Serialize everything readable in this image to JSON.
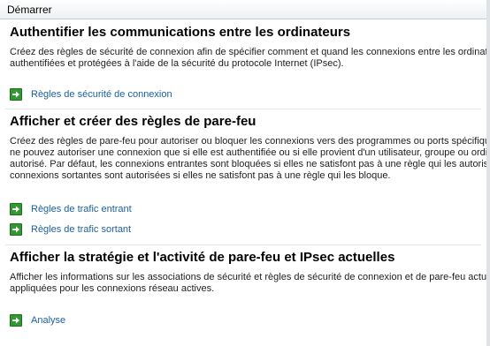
{
  "titlebar": {
    "title": "Démarrer"
  },
  "sections": [
    {
      "heading": "Authentifier les communications entre les ordinateurs",
      "desc_lines": [
        "Créez des règles de sécurité de connexion afin de spécifier comment et quand les connexions entre les ordinateurs",
        "authentifiées et protégées à l'aide de la sécurité du protocole Internet (IPsec)."
      ],
      "links": [
        {
          "label": "Règles de sécurité de connexion",
          "icon": "green-arrow-icon"
        }
      ]
    },
    {
      "heading": "Afficher et créer des règles de pare-feu",
      "desc_lines": [
        "Créez des règles de pare-feu pour autoriser ou bloquer les connexions vers des programmes ou ports spécifiques. V",
        "ne pouvez autoriser une connexion que si elle est authentifiée ou si elle provient d'un utilisateur, groupe ou ordinate",
        "autorisé. Par défaut, les connexions entrantes sont bloquées si elles ne satisfont pas à une règle qui les autorise, et",
        "connexions sortantes sont autorisées si elles ne satisfont pas à une règle qui les bloque."
      ],
      "links": [
        {
          "label": "Règles de trafic entrant",
          "icon": "green-arrow-icon"
        },
        {
          "label": "Règles de trafic sortant",
          "icon": "green-arrow-icon"
        }
      ]
    },
    {
      "heading": "Afficher la stratégie et l'activité de pare-feu et IPsec actuelles",
      "desc_lines": [
        "Afficher les informations sur les associations de sécurité et règles de sécurité de connexion et de pare-feu actuelles",
        "appliquées pour les connexions réseau actives."
      ],
      "links": [
        {
          "label": "Analyse",
          "icon": "green-arrow-icon"
        }
      ]
    }
  ],
  "colors": {
    "link": "#1a5fa8",
    "icon_green": "#2f9a2f"
  }
}
